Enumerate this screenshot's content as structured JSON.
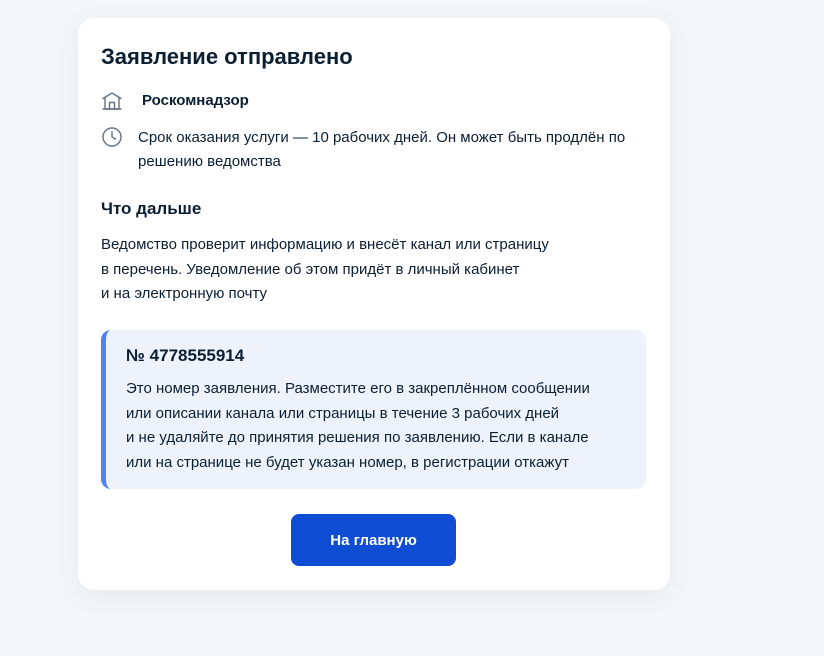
{
  "card": {
    "title": "Заявление отправлено",
    "organization": {
      "icon": "building-icon",
      "name": "Роскомнадзор"
    },
    "term": {
      "icon": "clock-icon",
      "text": "Срок оказания услуги — 10 рабочих дней. Он может быть продлён по решению ведомства"
    },
    "next_steps": {
      "heading": "Что дальше",
      "lines": [
        "Ведомство проверит информацию и внесёт канал или страницу",
        "в перечень. Уведомление об этом придёт в личный кабинет",
        "и на электронную почту"
      ]
    },
    "notice": {
      "number": "№ 4778555914",
      "lines": [
        "Это номер заявления. Разместите его в закреплённом сообщении",
        "или описании канала или страницы в течение 3 рабочих дней",
        "и не удаляйте до принятия решения по заявлению. Если в канале",
        "или на странице не будет указан номер, в регистрации откажут"
      ]
    },
    "home_button_label": "На главную"
  },
  "colors": {
    "background": "#f5f6f9",
    "card": "#ffffff",
    "text": "#0b1f33",
    "notice_background": "#edf2fb",
    "notice_accent": "#5384ec",
    "primary_button": "#0d4cd3"
  }
}
